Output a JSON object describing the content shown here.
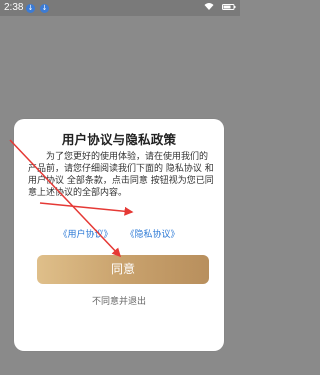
{
  "status_bar": {
    "time": "2:38",
    "badge_1": "↓",
    "badge_2": "↓",
    "wifi_icon": "wifi-icon",
    "battery_icon": "battery-icon"
  },
  "dialog": {
    "title": "用户协议与隐私政策",
    "body": "为了您更好的使用体验，请在使用我们的产品前，请您仔细阅读我们下面的 隐私协议 和 用户协议 全部条款，点击同意 按钮视为您已同意上述协议的全部内容。",
    "links": {
      "user_agreement": "《用户协议》",
      "privacy_policy": "《隐私协议》"
    },
    "agree_button": "同意",
    "disagree_link": "不同意并退出"
  },
  "annotations": {
    "arrow_color": "#e53935"
  }
}
